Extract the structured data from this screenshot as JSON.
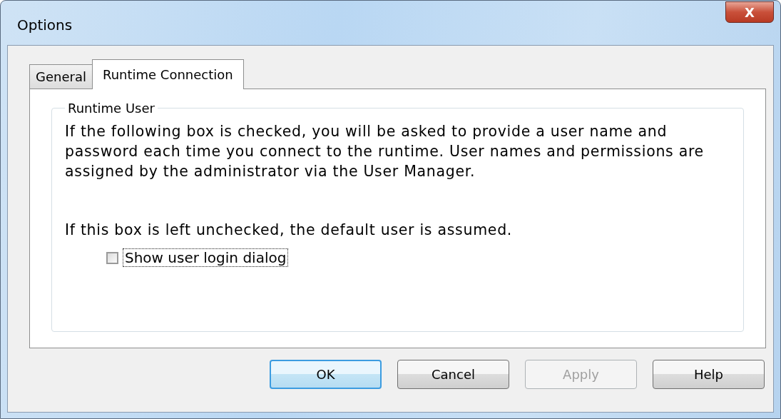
{
  "window": {
    "title": "Options",
    "close": "X"
  },
  "tabs": [
    {
      "label": "General",
      "selected": false
    },
    {
      "label": "Runtime Connection",
      "selected": true
    }
  ],
  "group": {
    "title": "Runtime User",
    "paragraphs": [
      "If the following box is checked, you will be asked to provide a user name and password each time you connect to the runtime.  User names and permissions are assigned by the administrator via the User Manager.",
      "If this box is left unchecked, the default user is assumed."
    ],
    "checkbox": {
      "label": "Show user login dialog",
      "checked": false
    }
  },
  "buttons": [
    {
      "label": "OK",
      "default": true,
      "disabled": false
    },
    {
      "label": "Cancel",
      "default": false,
      "disabled": false
    },
    {
      "label": "Apply",
      "default": false,
      "disabled": true
    },
    {
      "label": "Help",
      "default": false,
      "disabled": false
    }
  ]
}
